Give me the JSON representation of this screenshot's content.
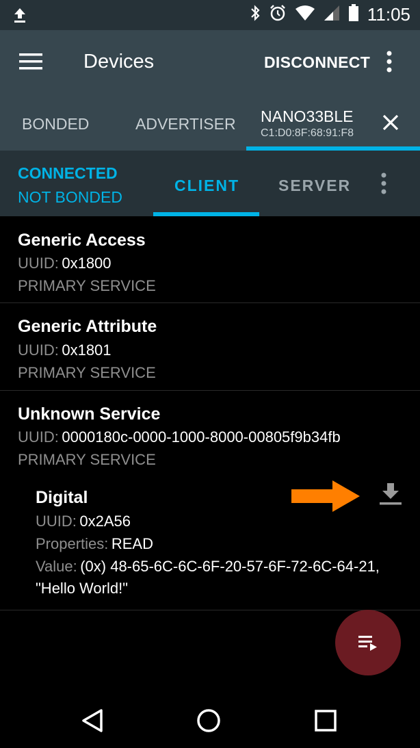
{
  "status_bar": {
    "time": "11:05",
    "icons": [
      "upload-icon",
      "bluetooth-icon",
      "alarm-icon",
      "wifi-icon",
      "signal-icon",
      "battery-icon"
    ]
  },
  "toolbar": {
    "title": "Devices",
    "disconnect_label": "DISCONNECT",
    "icons": [
      "menu-icon",
      "more-vert-icon"
    ]
  },
  "tabs": {
    "bonded": "BONDED",
    "advertiser": "ADVERTISER",
    "device_name": "NANO33BLE",
    "device_mac": "C1:D0:8F:68:91:F8"
  },
  "connection": {
    "state": "CONNECTED",
    "bond_state": "NOT BONDED",
    "client_tab": "CLIENT",
    "server_tab": "SERVER"
  },
  "labels": {
    "uuid": "UUID:",
    "properties": "Properties:",
    "value": "Value:"
  },
  "services": [
    {
      "name": "Generic Access",
      "uuid": "0x1800",
      "type": "PRIMARY SERVICE"
    },
    {
      "name": "Generic Attribute",
      "uuid": "0x1801",
      "type": "PRIMARY SERVICE"
    },
    {
      "name": "Unknown Service",
      "uuid": "0000180c-0000-1000-8000-00805f9b34fb",
      "type": "PRIMARY SERVICE"
    }
  ],
  "characteristic": {
    "name": "Digital",
    "uuid": "0x2A56",
    "properties": "READ",
    "value_hex": "(0x) 48-65-6C-6C-6F-20-57-6F-72-6C-64-21,",
    "value_text": "\"Hello World!\""
  },
  "colors": {
    "accent": "#00b3e6",
    "toolbar": "#37474f",
    "fab": "#6b1b22",
    "annotation_arrow": "#ff7f00"
  }
}
